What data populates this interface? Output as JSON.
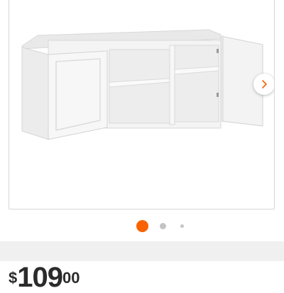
{
  "product": {
    "image_name": "white-wall-cabinet-open-door",
    "price": {
      "currency": "$",
      "dollars": "109",
      "cents": "00"
    }
  },
  "carousel": {
    "next_icon": "chevron-right-icon",
    "total_slides": 3,
    "active_index": 0
  },
  "colors": {
    "accent": "#f96302",
    "dot_inactive": "#c4c4c4",
    "card_border": "#d6d6d6",
    "band": "#f0f0f0",
    "price_text": "#2b2b2b"
  }
}
